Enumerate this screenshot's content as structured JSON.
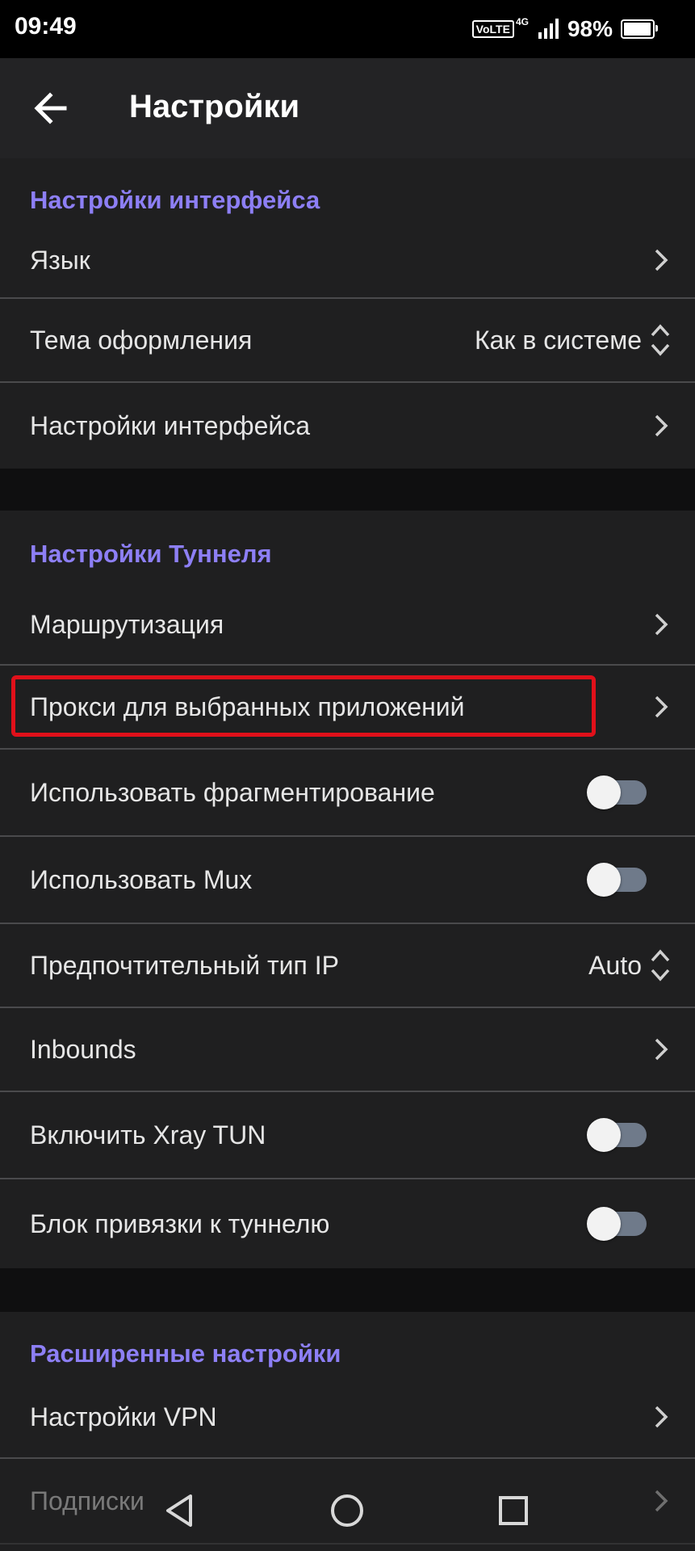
{
  "status": {
    "time": "09:49",
    "volte": "VoLTE",
    "network": "4G",
    "battery": "98%",
    "battery_level": 0.98
  },
  "header": {
    "title": "Настройки",
    "back_icon": "arrow-left-icon"
  },
  "sections": [
    {
      "title": "Настройки интерфейса",
      "rows": [
        {
          "label": "Язык",
          "type": "link"
        },
        {
          "label": "Тема оформления",
          "type": "select",
          "value": "Как в системе"
        },
        {
          "label": "Настройки интерфейса",
          "type": "link"
        }
      ]
    },
    {
      "title": "Настройки Туннеля",
      "rows": [
        {
          "label": "Маршрутизация",
          "type": "link"
        },
        {
          "label": "Прокси для выбранных приложений",
          "type": "link",
          "highlighted": true
        },
        {
          "label": "Использовать фрагментирование",
          "type": "switch",
          "on": false
        },
        {
          "label": "Использовать Mux",
          "type": "switch",
          "on": false
        },
        {
          "label": "Предпочтительный тип IP",
          "type": "select",
          "value": "Auto"
        },
        {
          "label": "Inbounds",
          "type": "link"
        },
        {
          "label": "Включить Xray TUN",
          "type": "switch",
          "on": false
        },
        {
          "label": "Блок привязки к туннелю",
          "type": "switch",
          "on": false
        }
      ]
    },
    {
      "title": "Расширенные настройки",
      "rows": [
        {
          "label": "Настройки VPN",
          "type": "link"
        },
        {
          "label": "Подписки",
          "type": "link"
        }
      ]
    }
  ],
  "colors": {
    "accent": "#8d7ff5",
    "background": "#0f0f10",
    "surface": "#1f1f20",
    "highlight": "#e0101a"
  },
  "nav": {
    "back": "triangle-back-icon",
    "home": "circle-home-icon",
    "recents": "square-recents-icon"
  }
}
